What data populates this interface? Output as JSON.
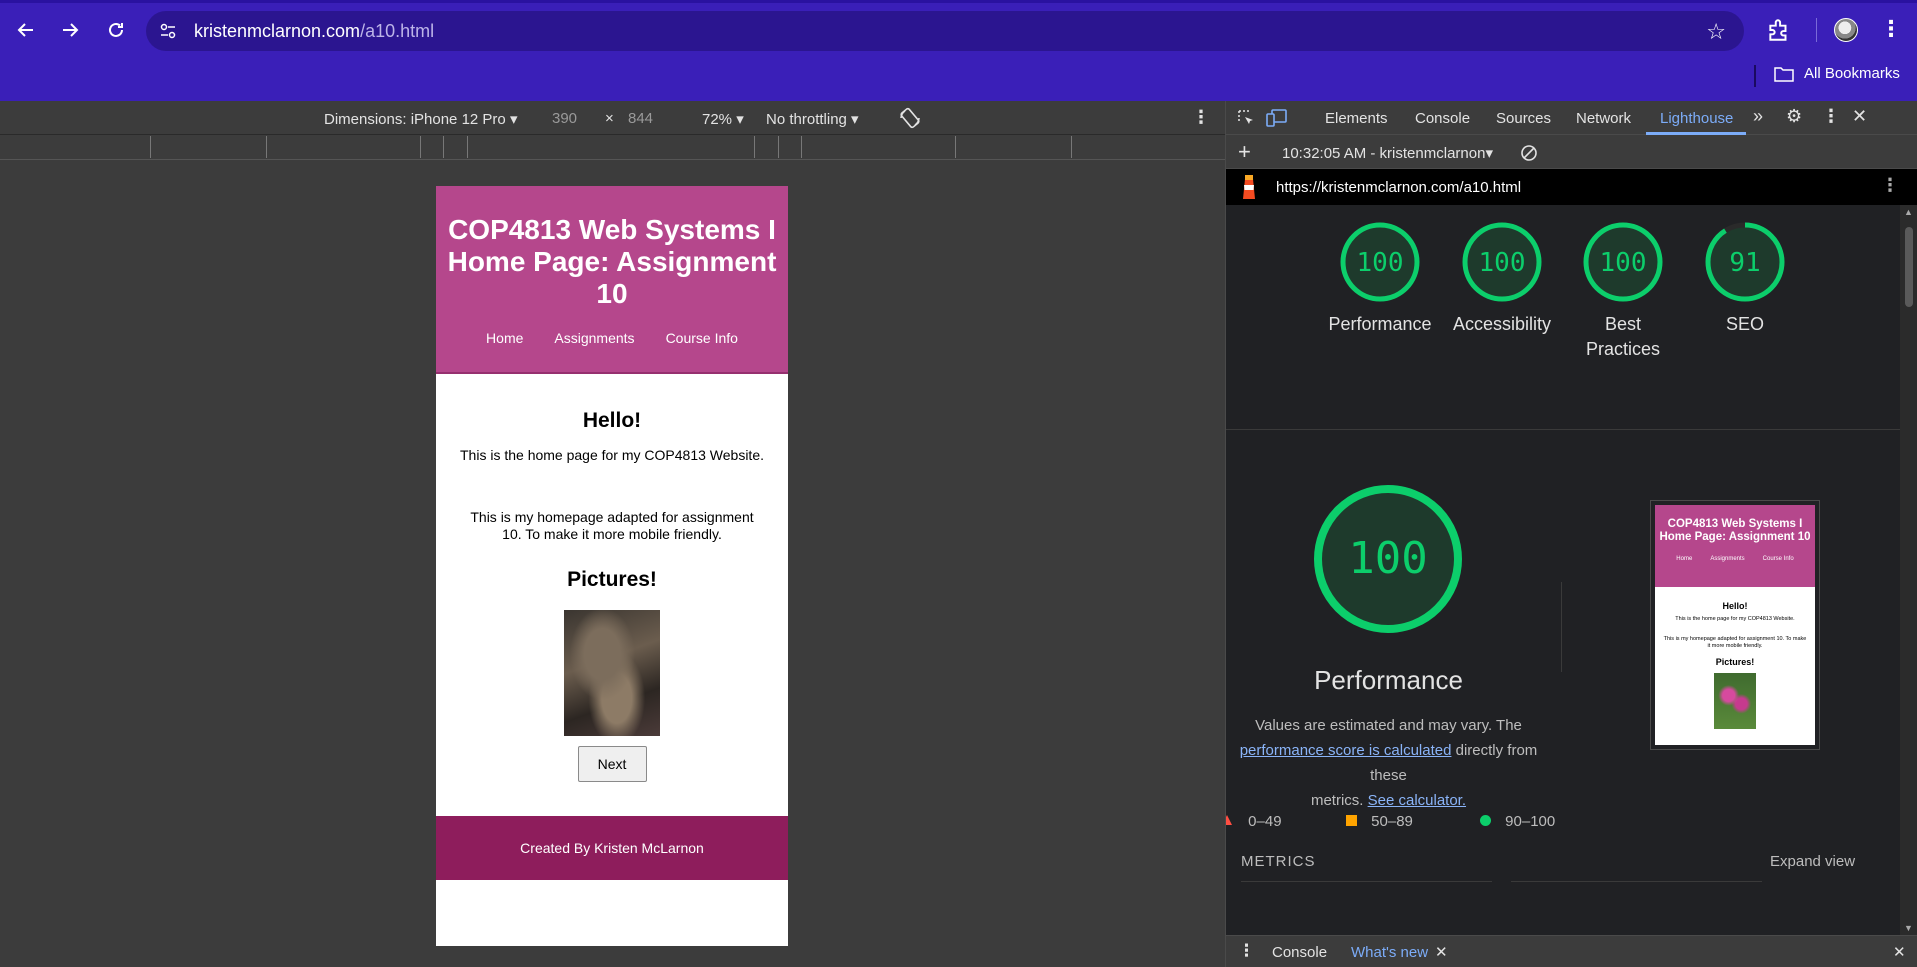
{
  "browser": {
    "url_host": "kristenmclarnon.com",
    "url_path": "/a10.html",
    "bookmarks_label": "All Bookmarks"
  },
  "device_toolbar": {
    "dimensions": "Dimensions: iPhone 12 Pro",
    "width": "390",
    "times": "×",
    "height": "844",
    "zoom": "72%",
    "throttling": "No throttling"
  },
  "site": {
    "title": "COP4813 Web Systems I Home Page: Assignment 10",
    "nav": [
      "Home",
      "Assignments",
      "Course Info"
    ],
    "hello": "Hello!",
    "intro": "This is the home page for my COP4813 Website.",
    "adapted": "This is my homepage adapted for assignment 10. To make it more mobile friendly.",
    "pictures": "Pictures!",
    "next_label": "Next",
    "footer": "Created By Kristen McLarnon"
  },
  "devtools": {
    "tabs": [
      "Elements",
      "Console",
      "Sources",
      "Network",
      "Lighthouse"
    ],
    "active_tab": "Lighthouse",
    "report_label": "10:32:05 AM - kristenmclarnon",
    "report_url": "https://kristenmclarnon.com/a10.html",
    "drawer_tabs": [
      "Console",
      "What's new"
    ]
  },
  "lighthouse": {
    "scores": [
      {
        "label": "Performance",
        "value": 100
      },
      {
        "label": "Accessibility",
        "value": 100
      },
      {
        "label": "Best Practices",
        "value": 100
      },
      {
        "label": "SEO",
        "value": 91
      }
    ],
    "perf_score": "100",
    "perf_title": "Performance",
    "perf_desc_1": "Values are estimated and may vary. The",
    "perf_desc_link": "performance score is calculated",
    "perf_desc_2": "directly from these",
    "perf_desc_3": "metrics.",
    "perf_desc_link2": "See calculator.",
    "legend": [
      "0–49",
      "50–89",
      "90–100"
    ],
    "metrics_heading": "METRICS",
    "expand_view": "Expand view",
    "colors": {
      "pass": "#0cce6b",
      "average": "#ffa400",
      "fail": "#ff4e42"
    }
  },
  "thumbnail": {
    "title": "COP4813 Web Systems I Home Page: Assignment 10",
    "nav": [
      "Home",
      "Assignments",
      "Course Info"
    ],
    "hello": "Hello!",
    "intro": "This is the home page for my COP4813 Website.",
    "adapted": "This is my homepage adapted for assignment 10. To make it more mobile friendly.",
    "pictures": "Pictures!"
  }
}
